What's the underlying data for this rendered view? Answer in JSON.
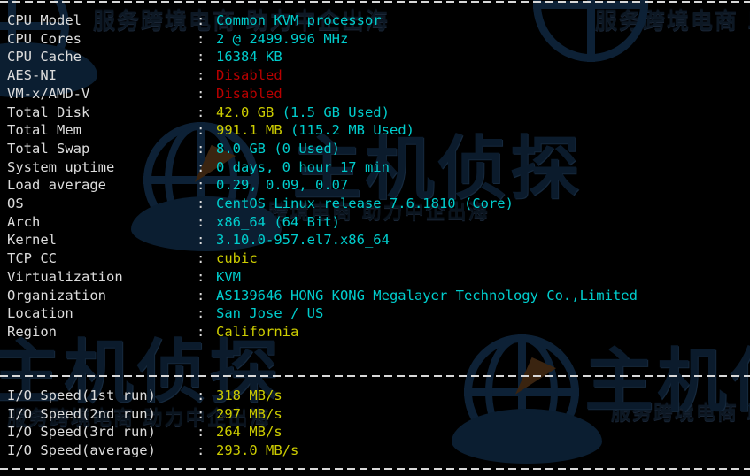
{
  "terminal": {
    "background": "#000000",
    "label_color": "#dcdcdc",
    "cyan": "#00cdcd",
    "yellow": "#cdcd00",
    "red": "#b90000",
    "separator_char": "-"
  },
  "watermark": {
    "tagline": "服务跨境电商 助力中企出海",
    "brand": "主机侦探",
    "color": "#0d1824"
  },
  "sysinfo": [
    {
      "label": "CPU Model",
      "colon": ":",
      "parts": [
        {
          "text": "Common KVM processor",
          "color": "cyan"
        }
      ]
    },
    {
      "label": "CPU Cores",
      "colon": ":",
      "parts": [
        {
          "text": "2 @ 2499.996 MHz",
          "color": "cyan"
        }
      ]
    },
    {
      "label": "CPU Cache",
      "colon": ":",
      "parts": [
        {
          "text": "16384 KB",
          "color": "cyan"
        }
      ]
    },
    {
      "label": "AES-NI",
      "colon": ":",
      "parts": [
        {
          "text": "Disabled",
          "color": "red"
        }
      ]
    },
    {
      "label": "VM-x/AMD-V",
      "colon": ":",
      "parts": [
        {
          "text": "Disabled",
          "color": "red"
        }
      ]
    },
    {
      "label": "Total Disk",
      "colon": ":",
      "parts": [
        {
          "text": "42.0 GB ",
          "color": "yellow"
        },
        {
          "text": "(1.5 GB Used)",
          "color": "cyan"
        }
      ]
    },
    {
      "label": "Total Mem",
      "colon": ":",
      "parts": [
        {
          "text": "991.1 MB ",
          "color": "yellow"
        },
        {
          "text": "(115.2 MB Used)",
          "color": "cyan"
        }
      ]
    },
    {
      "label": "Total Swap",
      "colon": ":",
      "parts": [
        {
          "text": "8.0 GB (0 Used)",
          "color": "cyan"
        }
      ]
    },
    {
      "label": "System uptime",
      "colon": ":",
      "parts": [
        {
          "text": "0 days, 0 hour 17 min",
          "color": "cyan"
        }
      ]
    },
    {
      "label": "Load average",
      "colon": ":",
      "parts": [
        {
          "text": "0.29, 0.09, 0.07",
          "color": "cyan"
        }
      ]
    },
    {
      "label": "OS",
      "colon": ":",
      "parts": [
        {
          "text": "CentOS Linux release 7.6.1810 (Core)",
          "color": "cyan"
        }
      ]
    },
    {
      "label": "Arch",
      "colon": ":",
      "parts": [
        {
          "text": "x86_64 (64 Bit)",
          "color": "cyan"
        }
      ]
    },
    {
      "label": "Kernel",
      "colon": ":",
      "parts": [
        {
          "text": "3.10.0-957.el7.x86_64",
          "color": "cyan"
        }
      ]
    },
    {
      "label": "TCP CC",
      "colon": ":",
      "parts": [
        {
          "text": "cubic",
          "color": "yellow"
        }
      ]
    },
    {
      "label": "Virtualization",
      "colon": ":",
      "parts": [
        {
          "text": "KVM",
          "color": "cyan"
        }
      ]
    },
    {
      "label": "Organization",
      "colon": ":",
      "parts": [
        {
          "text": "AS139646 HONG KONG Megalayer Technology Co.,Limited",
          "color": "cyan"
        }
      ]
    },
    {
      "label": "Location",
      "colon": ":",
      "parts": [
        {
          "text": "San Jose / US",
          "color": "cyan"
        }
      ]
    },
    {
      "label": "Region",
      "colon": ":",
      "parts": [
        {
          "text": "California",
          "color": "yellow"
        }
      ]
    }
  ],
  "iospeed": [
    {
      "label": "I/O Speed(1st run)",
      "colon": ":",
      "parts": [
        {
          "text": "318 MB/s",
          "color": "yellow"
        }
      ]
    },
    {
      "label": "I/O Speed(2nd run)",
      "colon": ":",
      "parts": [
        {
          "text": "297 MB/s",
          "color": "yellow"
        }
      ]
    },
    {
      "label": "I/O Speed(3rd run)",
      "colon": ":",
      "parts": [
        {
          "text": "264 MB/s",
          "color": "yellow"
        }
      ]
    },
    {
      "label": "I/O Speed(average)",
      "colon": ":",
      "parts": [
        {
          "text": "293.0 MB/s",
          "color": "yellow"
        }
      ]
    }
  ]
}
